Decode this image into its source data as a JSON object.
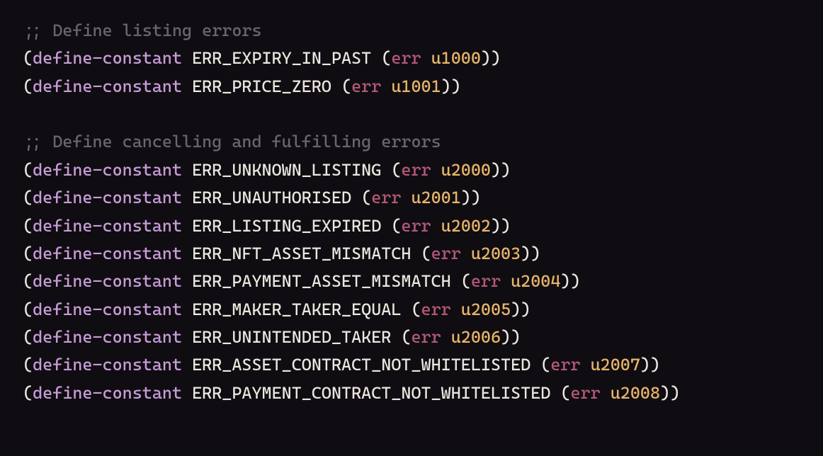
{
  "comments": {
    "listing": ";; Define listing errors",
    "cancel_fulfil": ";; Define cancelling and fulfilling errors"
  },
  "tokens": {
    "define_constant": "define-constant",
    "err_fn": "err",
    "lp": "(",
    "rp": ")"
  },
  "errors": {
    "listing": [
      {
        "name": "ERR_EXPIRY_IN_PAST",
        "code": "u1000"
      },
      {
        "name": "ERR_PRICE_ZERO",
        "code": "u1001"
      }
    ],
    "cancel_fulfil": [
      {
        "name": "ERR_UNKNOWN_LISTING",
        "code": "u2000"
      },
      {
        "name": "ERR_UNAUTHORISED",
        "code": "u2001"
      },
      {
        "name": "ERR_LISTING_EXPIRED",
        "code": "u2002"
      },
      {
        "name": "ERR_NFT_ASSET_MISMATCH",
        "code": "u2003"
      },
      {
        "name": "ERR_PAYMENT_ASSET_MISMATCH",
        "code": "u2004"
      },
      {
        "name": "ERR_MAKER_TAKER_EQUAL",
        "code": "u2005"
      },
      {
        "name": "ERR_UNINTENDED_TAKER",
        "code": "u2006"
      },
      {
        "name": "ERR_ASSET_CONTRACT_NOT_WHITELISTED",
        "code": "u2007"
      },
      {
        "name": "ERR_PAYMENT_CONTRACT_NOT_WHITELISTED",
        "code": "u2008"
      }
    ]
  }
}
